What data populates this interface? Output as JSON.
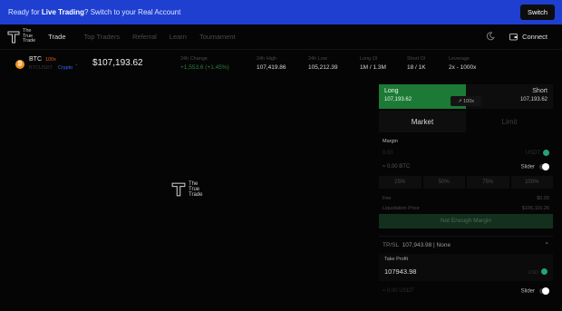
{
  "banner": {
    "prefix": "Ready for ",
    "highlight": "Live Trading",
    "suffix": "? Switch to your Real Account",
    "button": "Switch"
  },
  "logo": {
    "line1": "The",
    "line2": "True",
    "line3": "Trade"
  },
  "nav": {
    "items": [
      "Trade",
      "Top Traders",
      "Referral",
      "Learn",
      "Tournament"
    ],
    "active_index": 0
  },
  "connect_label": "Connect",
  "ticker": {
    "symbol": "BTC",
    "leverage_badge": "100x",
    "sub": "BTCUSDT",
    "sub_badge": "Crypto",
    "price": "$107,193.62",
    "stats": [
      {
        "label": "24h Change",
        "value": "+1,553.6 (+1.45%)",
        "positive": true
      },
      {
        "label": "24h High",
        "value": "107,419.86",
        "positive": false
      },
      {
        "label": "24h Low",
        "value": "105,212.39",
        "positive": false
      },
      {
        "label": "Long OI",
        "value": "1M / 1.3M",
        "positive": false
      },
      {
        "label": "Short OI",
        "value": "18 / 1K",
        "positive": false
      },
      {
        "label": "Leverage",
        "value": "2x - 1000x",
        "positive": false
      }
    ]
  },
  "panel": {
    "long_label": "Long",
    "long_price": "107,193.62",
    "short_label": "Short",
    "short_price": "107,193.62",
    "leverage_chip": "100x",
    "tab_market": "Market",
    "tab_limit": "Limit",
    "margin_label": "Margin",
    "margin_placeholder": "0.00",
    "margin_unit": "USDT",
    "btc_equiv": "≈ 0.00 BTC",
    "slider_label": "Slider",
    "pcts": [
      "25%",
      "50%",
      "75%",
      "100%"
    ],
    "fee_label": "Fee",
    "fee_value": "$0.00",
    "liq_label": "Liquidation Price",
    "liq_value": "$106,116.26",
    "submit_label": "Not Enough Margin",
    "tpsl_label": "TP/SL",
    "tpsl_tp": "107,943.98",
    "tpsl_sl": "None",
    "tp_label": "Take Profit",
    "tp_value": "107943.98",
    "tp_unit": "USD",
    "sl_equiv": "≈ 0.00 USDT",
    "slider2_label": "Slider"
  },
  "colors": {
    "banner": "#1e3fd0",
    "long": "#1c7a36",
    "btc": "#f7931a",
    "lev": "#e55b1e"
  }
}
